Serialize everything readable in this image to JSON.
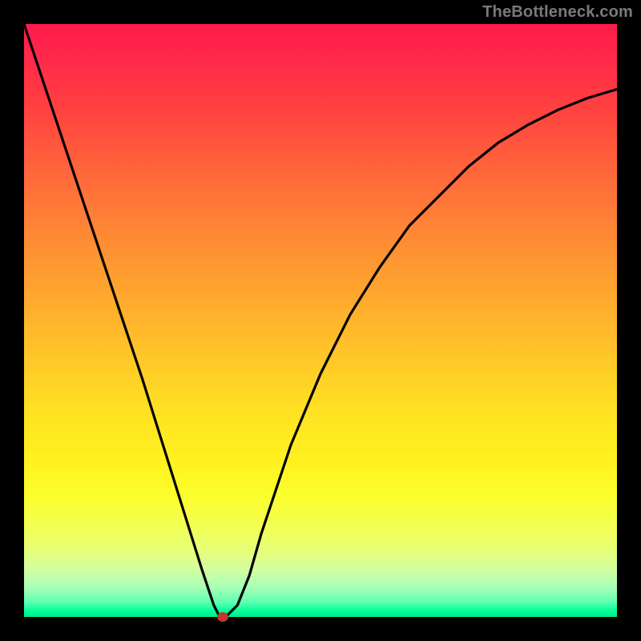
{
  "watermark": "TheBottleneck.com",
  "colors": {
    "frame": "#000000",
    "curve": "#000000",
    "marker": "#c0392b"
  },
  "chart_data": {
    "type": "line",
    "title": "",
    "xlabel": "",
    "ylabel": "",
    "xlim": [
      0,
      100
    ],
    "ylim": [
      0,
      100
    ],
    "grid": false,
    "series": [
      {
        "name": "bottleneck-curve",
        "x": [
          0,
          5,
          10,
          15,
          20,
          25,
          30,
          32,
          33,
          34,
          35,
          36,
          38,
          40,
          45,
          50,
          55,
          60,
          65,
          70,
          75,
          80,
          85,
          90,
          95,
          100
        ],
        "values": [
          100,
          85,
          70,
          55,
          40,
          24,
          8,
          2,
          0,
          0,
          1,
          2,
          7,
          14,
          29,
          41,
          51,
          59,
          66,
          71,
          76,
          80,
          83,
          85.5,
          87.5,
          89
        ]
      }
    ],
    "annotations": [
      {
        "name": "optimal-point",
        "x": 33.5,
        "y": 0
      }
    ]
  }
}
